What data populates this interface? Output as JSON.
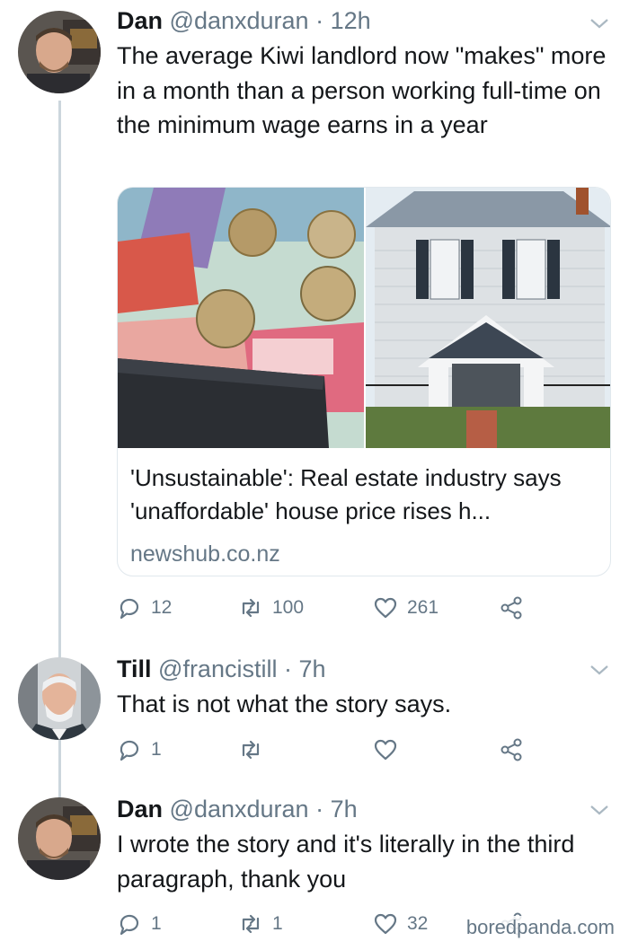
{
  "tweets": [
    {
      "name": "Dan",
      "handle": "@danxduran",
      "dot": "·",
      "time": "12h",
      "text": "The average Kiwi landlord now \"makes\" more in a month than a person working full-time on the minimum wage earns in a year",
      "card": {
        "title": "'Unsustainable': Real estate industry says 'unaffordable' house price rises h...",
        "domain": "newshub.co.nz"
      },
      "reply_count": "12",
      "retweet_count": "100",
      "like_count": "261"
    },
    {
      "name": "Till",
      "handle": "@francistill",
      "dot": "·",
      "time": "7h",
      "text": "That is not what the story says.",
      "reply_count": "1",
      "retweet_count": "",
      "like_count": ""
    },
    {
      "name": "Dan",
      "handle": "@danxduran",
      "dot": "·",
      "time": "7h",
      "text": "I wrote the story and it's literally in the third paragraph, thank you",
      "reply_count": "1",
      "retweet_count": "1",
      "like_count": "32"
    }
  ],
  "watermark": "boredpanda.com",
  "colors": {
    "text": "#14171a",
    "secondary": "#657786",
    "border": "#e1e8ed",
    "thread_line": "#ccd6dd"
  },
  "icons": [
    "reply-icon",
    "retweet-icon",
    "like-icon",
    "share-icon",
    "chevron-down-icon"
  ]
}
